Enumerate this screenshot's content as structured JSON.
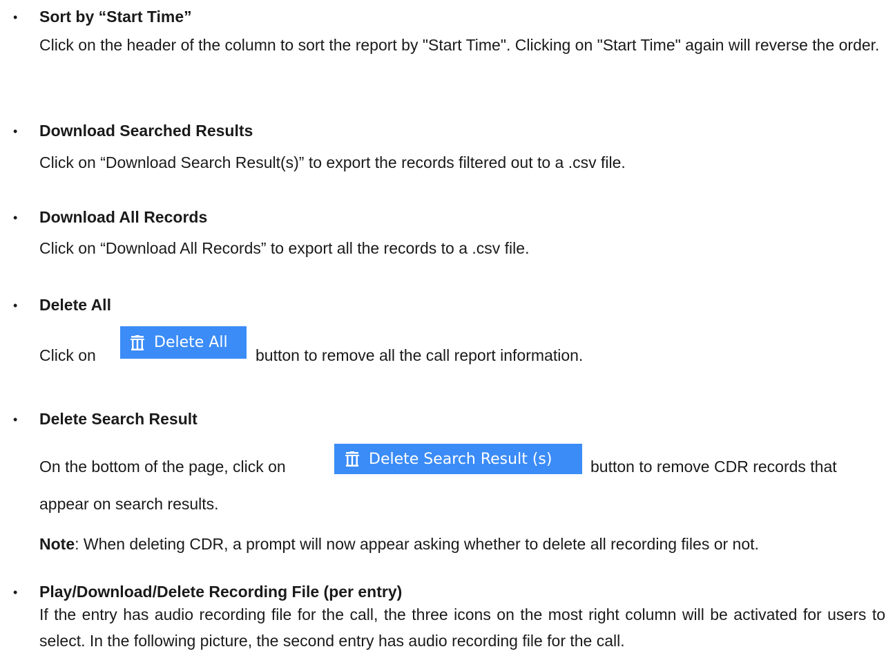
{
  "sections": [
    {
      "title": "Sort by “Start Time”",
      "body": "Click on the header of the column to sort the report by \"Start Time\". Clicking on \"Start Time\" again will reverse the order."
    },
    {
      "title": "Download Searched Results",
      "body": "Click on “Download Search Result(s)” to export the records filtered out to a .csv file."
    },
    {
      "title": "Download All Records",
      "body": "Click on “Download All Records” to export all the records to a .csv file."
    },
    {
      "title": "Delete All",
      "body_prefix": "Click on",
      "button_label": "Delete All",
      "body_suffix": "button to remove all the call report information."
    },
    {
      "title": "Delete Search Result",
      "body_prefix": "On the bottom of the page, click on",
      "button_label": "Delete Search Result (s)",
      "body_suffix": "button to remove CDR records that",
      "body_line2": "appear on search results.",
      "note_label": "Note",
      "note_text": ": When deleting CDR, a prompt will now appear asking whether to delete all recording files or not."
    },
    {
      "title": "Play/Download/Delete Recording File (per entry)",
      "body": "If the entry has audio recording file for the call, the three icons on the most right column will be activated for users to select. In the following picture, the second entry has audio recording file for the call."
    }
  ],
  "bullet_glyph": "•",
  "colors": {
    "button_bg": "#3b8cf7",
    "button_text": "#ffffff",
    "text": "#1a1a1a"
  },
  "icons": {
    "button_icon": "trash-icon"
  }
}
